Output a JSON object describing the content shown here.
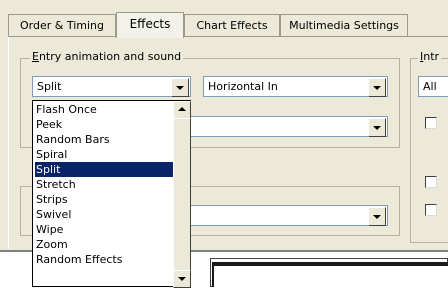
{
  "tabs": [
    {
      "label": "Order & Timing"
    },
    {
      "label": "Effects"
    },
    {
      "label": "Chart Effects"
    },
    {
      "label": "Multimedia Settings"
    }
  ],
  "entry_group": {
    "label_prefix": "",
    "label_underlined": "E",
    "label_rest": "ntry animation and sound",
    "effect_value": "Split",
    "direction_value": "Horizontal In"
  },
  "intro_group": {
    "label_underlined": "I",
    "label_rest": "ntr",
    "value": "All"
  },
  "dropdown": {
    "items": [
      "Flash Once",
      "Peek",
      "Random Bars",
      "Spiral",
      "Split",
      "Stretch",
      "Strips",
      "Swivel",
      "Wipe",
      "Zoom",
      "Random Effects"
    ],
    "selected": "Split"
  }
}
